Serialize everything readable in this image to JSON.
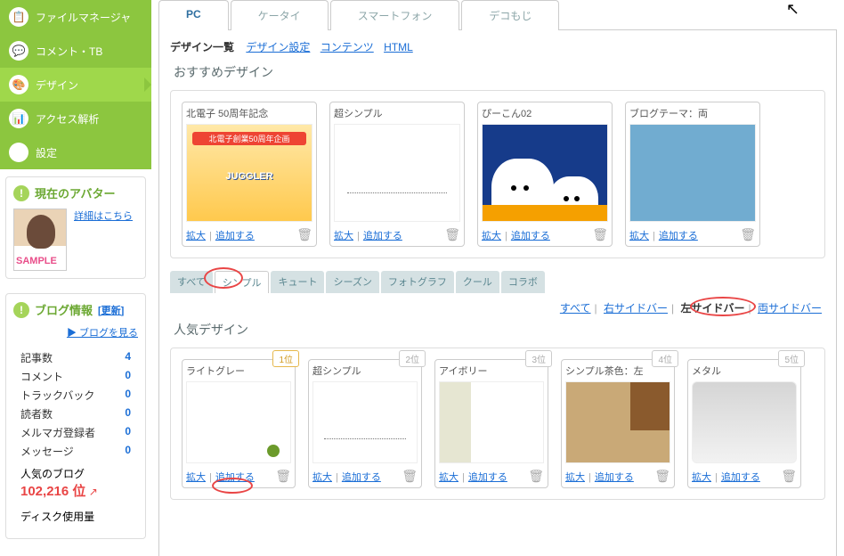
{
  "cursor": "↖",
  "nav": {
    "items": [
      {
        "label": "ファイルマネージャ",
        "icon": "📋"
      },
      {
        "label": "コメント・TB",
        "icon": "💬"
      },
      {
        "label": "デザイン",
        "icon": "🎨"
      },
      {
        "label": "アクセス解析",
        "icon": "📊"
      },
      {
        "label": "設定",
        "icon": "⚙"
      }
    ]
  },
  "avatar_panel": {
    "title": "現在のアバター",
    "detail_link": "詳細はこちら"
  },
  "blog_panel": {
    "title": "ブログ情報",
    "update_link": "[更新]",
    "view_link": "▶ ブログを見る",
    "stats": [
      {
        "label": "記事数",
        "value": "4"
      },
      {
        "label": "コメント",
        "value": "0"
      },
      {
        "label": "トラックバック",
        "value": "0"
      },
      {
        "label": "読者数",
        "value": "0"
      },
      {
        "label": "メルマガ登録者",
        "value": "0"
      },
      {
        "label": "メッセージ",
        "value": "0"
      }
    ],
    "rank_label": "人気のブログ",
    "rank_value": "102,216 位",
    "rank_arrow": "↗",
    "disk_label": "ディスク使用量"
  },
  "tabs": [
    "PC",
    "ケータイ",
    "スマートフォン",
    "デコもじ"
  ],
  "crumbs": {
    "current": "デザイン一覧",
    "links": [
      "デザイン設定",
      "コンテンツ",
      "HTML"
    ]
  },
  "recommend": {
    "title": "おすすめデザイン",
    "items": [
      {
        "title": "北電子 50周年記念",
        "thumb": "juggler",
        "banner": "北電子創業50周年企画",
        "logo": "JUGGLER"
      },
      {
        "title": "超シンプル",
        "thumb": "simple"
      },
      {
        "title": "ぴーこん02",
        "thumb": "ghost"
      },
      {
        "title": "ブログテーマ：両",
        "thumb": "blue"
      }
    ]
  },
  "expand": "拡大",
  "add": "追加する",
  "filter_tabs": [
    "すべて",
    "シンプル",
    "キュート",
    "シーズン",
    "フォトグラフ",
    "クール",
    "コラボ"
  ],
  "sidebar_filter": {
    "all": "すべて",
    "right": "右サイドバー",
    "left": "左サイドバー",
    "both": "両サイドバー"
  },
  "popular": {
    "title": "人気デザイン",
    "items": [
      {
        "rank": "1位",
        "gold": true,
        "title": "ライトグレー",
        "thumb": "gray"
      },
      {
        "rank": "2位",
        "title": "超シンプル",
        "thumb": "simple"
      },
      {
        "rank": "3位",
        "title": "アイボリー",
        "thumb": "ivory"
      },
      {
        "rank": "4位",
        "title": "シンプル茶色：左",
        "thumb": "brown"
      },
      {
        "rank": "5位",
        "title": "メタル",
        "thumb": "metal"
      }
    ]
  }
}
